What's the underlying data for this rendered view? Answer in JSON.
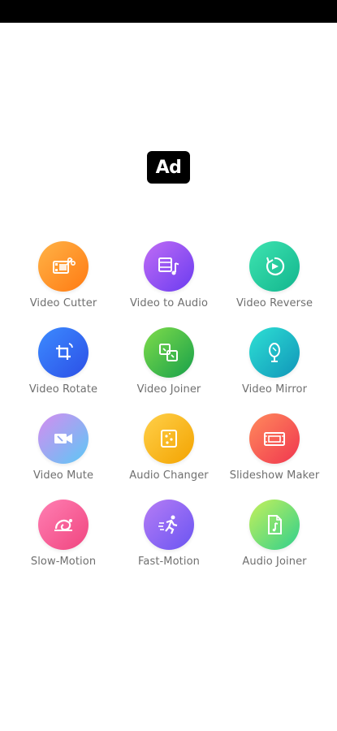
{
  "ad": {
    "label": "Ad"
  },
  "tools": [
    {
      "label": "Video Cutter",
      "icon": "film-scissors-icon",
      "gradient": [
        "#ffb347",
        "#ff7a12"
      ]
    },
    {
      "label": "Video to Audio",
      "icon": "film-note-icon",
      "gradient": [
        "#c06cf5",
        "#6a3cf0"
      ]
    },
    {
      "label": "Video Reverse",
      "icon": "reverse-play-icon",
      "gradient": [
        "#3ee4b0",
        "#12b58e"
      ]
    },
    {
      "label": "Video Rotate",
      "icon": "rotate-crop-icon",
      "gradient": [
        "#3c8bff",
        "#2c4fe6"
      ]
    },
    {
      "label": "Video Joiner",
      "icon": "joiner-icon",
      "gradient": [
        "#7fdc4a",
        "#17a04a"
      ]
    },
    {
      "label": "Video Mirror",
      "icon": "mirror-icon",
      "gradient": [
        "#2ee0d4",
        "#1095b9"
      ]
    },
    {
      "label": "Video Mute",
      "icon": "mute-camera-icon",
      "gradient": [
        "#d68cf0",
        "#5bc8f5"
      ]
    },
    {
      "label": "Audio Changer",
      "icon": "audio-changer-icon",
      "gradient": [
        "#ffd04a",
        "#f3a300"
      ]
    },
    {
      "label": "Slideshow Maker",
      "icon": "slideshow-icon",
      "gradient": [
        "#ff8a5c",
        "#f0364f"
      ]
    },
    {
      "label": "Slow-Motion",
      "icon": "slow-motion-icon",
      "gradient": [
        "#ff7fb3",
        "#f0457f"
      ]
    },
    {
      "label": "Fast-Motion",
      "icon": "fast-motion-icon",
      "gradient": [
        "#b57cf5",
        "#6a55f2"
      ]
    },
    {
      "label": "Audio Joiner",
      "icon": "audio-file-icon",
      "gradient": [
        "#c6f05a",
        "#2fd08d"
      ]
    }
  ]
}
